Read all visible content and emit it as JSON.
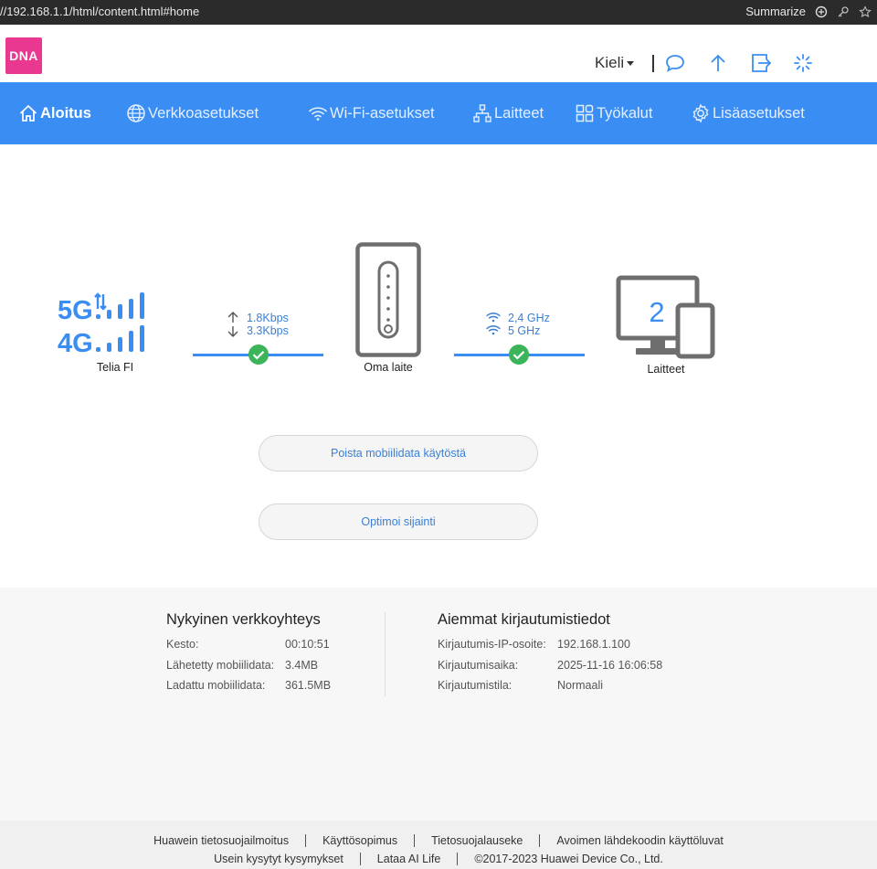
{
  "browser": {
    "url": "//192.168.1.1/html/content.html#home",
    "summarize_label": "Summarize"
  },
  "header": {
    "logo_text": "DNA",
    "language_label": "Kieli"
  },
  "nav": {
    "items": [
      {
        "label": "Aloitus",
        "icon": "home-icon"
      },
      {
        "label": "Verkkoasetukset",
        "icon": "globe-icon"
      },
      {
        "label": "Wi-Fi-asetukset",
        "icon": "wifi-icon"
      },
      {
        "label": "Laitteet",
        "icon": "network-icon"
      },
      {
        "label": "Työkalut",
        "icon": "tools-icon"
      },
      {
        "label": "Lisäasetukset",
        "icon": "gear-icon"
      }
    ]
  },
  "status": {
    "signal_5g": "5G",
    "signal_4g": "4G",
    "operator": "Telia FI",
    "upload_speed": "1.8Kbps",
    "download_speed": "3.3Kbps",
    "router_label": "Oma laite",
    "wifi_band_1": "2,4 GHz",
    "wifi_band_2": "5 GHz",
    "device_count": "2",
    "devices_label": "Laitteet"
  },
  "actions": {
    "disable_mobile_data": "Poista mobiilidata käytöstä",
    "optimize_location": "Optimoi sijainti"
  },
  "connection": {
    "title": "Nykyinen verkkoyhteys",
    "rows": [
      {
        "key": "Kesto:",
        "value": "00:10:51"
      },
      {
        "key": "Lähetetty mobiilidata:",
        "value": "3.4MB"
      },
      {
        "key": "Ladattu mobiilidata:",
        "value": "361.5MB"
      }
    ]
  },
  "login": {
    "title": "Aiemmat kirjautumistiedot",
    "rows": [
      {
        "key": "Kirjautumis-IP-osoite:",
        "value": "192.168.1.100"
      },
      {
        "key": "Kirjautumisaika:",
        "value": "2025-11-16 16:06:58"
      },
      {
        "key": "Kirjautumistila:",
        "value": "Normaali"
      }
    ]
  },
  "footer": {
    "row1": [
      "Huawein tietosuojailmoitus",
      "Käyttösopimus",
      "Tietosuojalauseke",
      "Avoimen lähdekoodin käyttöluvat"
    ],
    "row2": [
      "Usein kysytyt kysymykset",
      "Lataa AI Life",
      "©2017-2023 Huawei Device Co., Ltd."
    ]
  },
  "colors": {
    "nav_bg": "#3a8ef3",
    "accent_blue": "#3a7fd6",
    "brand_pink": "#e8388f",
    "ok_green": "#3cb55a",
    "icon_gray": "#707070"
  }
}
